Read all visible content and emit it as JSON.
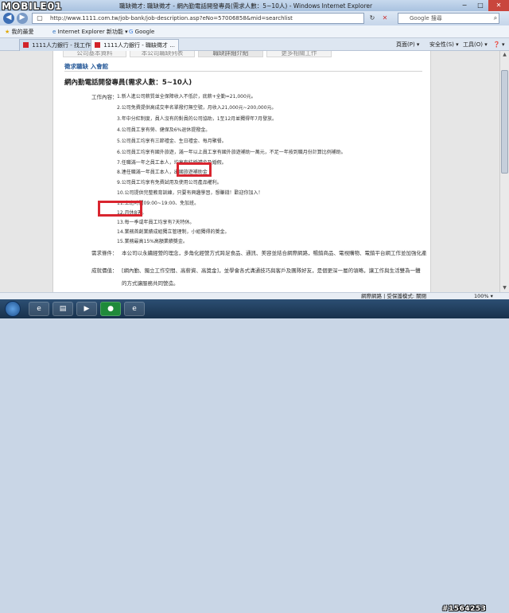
{
  "window": {
    "logo": "MOBILE01",
    "title": "職缺徵才: 職缺徵才 - 網內勤電話開發專員(需求人數：5~10人) - Windows Internet Explorer",
    "minimize": "−",
    "maximize": "□",
    "close": "✕"
  },
  "addressbar": {
    "back": "◀",
    "forward": "▶",
    "url": "http://www.1111.com.tw/job-bank/job-description.asp?eNo=57006858&mid=searchlist",
    "refresh": "↻",
    "stop": "✕",
    "search_placeholder": "Google 搜尋"
  },
  "favorites": {
    "label": "我的最愛",
    "items": [
      "Internet Explorer 新功能 ▾",
      "Google"
    ]
  },
  "tabs": [
    "1111人力銀行 - 找工作 -...",
    "1111人力銀行 - 職缺徵才 ..."
  ],
  "commandbar": [
    "頁面(P) ▾",
    "安全性(S) ▾",
    "工具(O) ▾",
    "❓ ▾"
  ],
  "page": {
    "tabs": [
      "公司基本資料",
      "本公司職缺列表",
      "職缺詳細介紹",
      "更多相關工作"
    ],
    "section": "徵求職缺 入會館",
    "job_title": "網內勤電話開發專員(需求人數：5~10人)",
    "work_label": "工作內容：",
    "items": [
      "1.新人進公司薪質並全保障收入不低於，底薪+全勤=21,000元。",
      "2.公司免費提供高成交率名單撥打無空號，月收入21,000元~200,000元。",
      "3.年中分紅制度，員人沒有的對員的公司協助，1至12月並獨得年7月發放。",
      "4.公司員工享有勞、健保及6%退休提撥金。",
      "5.公司員工均享有三節禮金、生日禮金、每月聚餐。",
      "6.公司員工均享有國外旅遊，滿一年以上員工享有國外旅遊補助一萬元，不足一年按到職月份計算比例補助。",
      "7.任職滿一年之員工本人，均享有結婚禮金及婚假。",
      "8.連任職滿一年員工本人，出國旅遊補助金",
      "9.公司員工均享有免費試用及使用公司產品權利。",
      "10.公司提供完整教育訓練，只要有興趣學習，想賺錢！歡迎你加入！",
      "11.上班時間09:00~19:00、免加班。",
      "12.月休8天。",
      "13.每一季或年員工均享有7天特休。",
      "14.業務首創業績成組獨立管理制，小組獨得的獎金。",
      "15.業務最高15%高額業績獎金。"
    ],
    "requirements_label": "需求條件：",
    "requirements_text": "本公司以永續經營的理念，多角化經營方式跨足食品、通訊、美容並結合網際網路，暢銷商品、電視購物、電銷平台網工作並加強化產",
    "rewards_label": "成就價值：",
    "rewards_text_1": "[網內勤、獨立工作空間、高薪資、高獎金]，並學會各式溝通技巧與客戶及團隊好友，是個更深一層的領略，讓工作與生活雙為一體",
    "rewards_text_2": "的方式讓服務共同營造。"
  },
  "status": {
    "zone": "網際網路 | 受保護模式: 關閉",
    "zoom": "100% ▾"
  },
  "taskbar": {
    "watermark": "#1564253"
  }
}
